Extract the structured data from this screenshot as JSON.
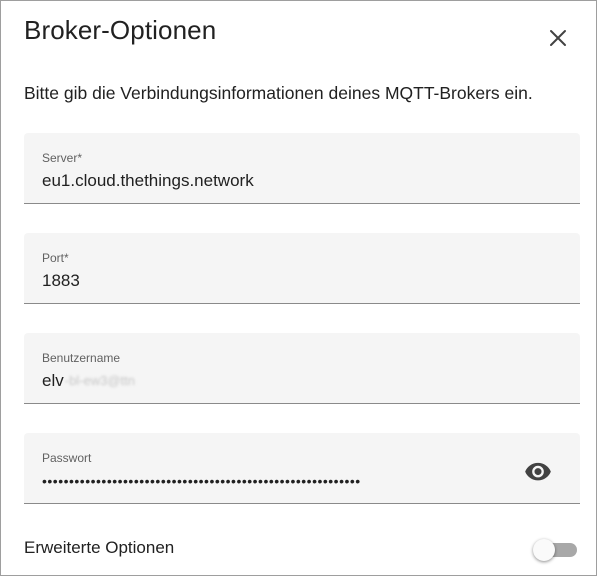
{
  "dialog": {
    "title": "Broker-Optionen",
    "description": "Bitte gib die Verbindungsinformationen deines MQTT-Brokers ein."
  },
  "fields": {
    "server": {
      "label": "Server*",
      "value": "eu1.cloud.thethings.network"
    },
    "port": {
      "label": "Port*",
      "value": "1883"
    },
    "username": {
      "label": "Benutzername",
      "value": "elv",
      "obscured_suffix": "-bl-ew3@ttn"
    },
    "password": {
      "label": "Passwort",
      "value": "•••••••••••••••••••••••••••••••••••••••••••••••••••••••••••"
    }
  },
  "advanced": {
    "label": "Erweiterte Optionen",
    "enabled": false
  },
  "icons": {
    "close": "close-icon",
    "visibility": "eye-icon"
  },
  "colors": {
    "field_bg": "#f5f5f5",
    "text": "#212121",
    "label": "#616161",
    "toggle_track": "#9e9e9e"
  }
}
